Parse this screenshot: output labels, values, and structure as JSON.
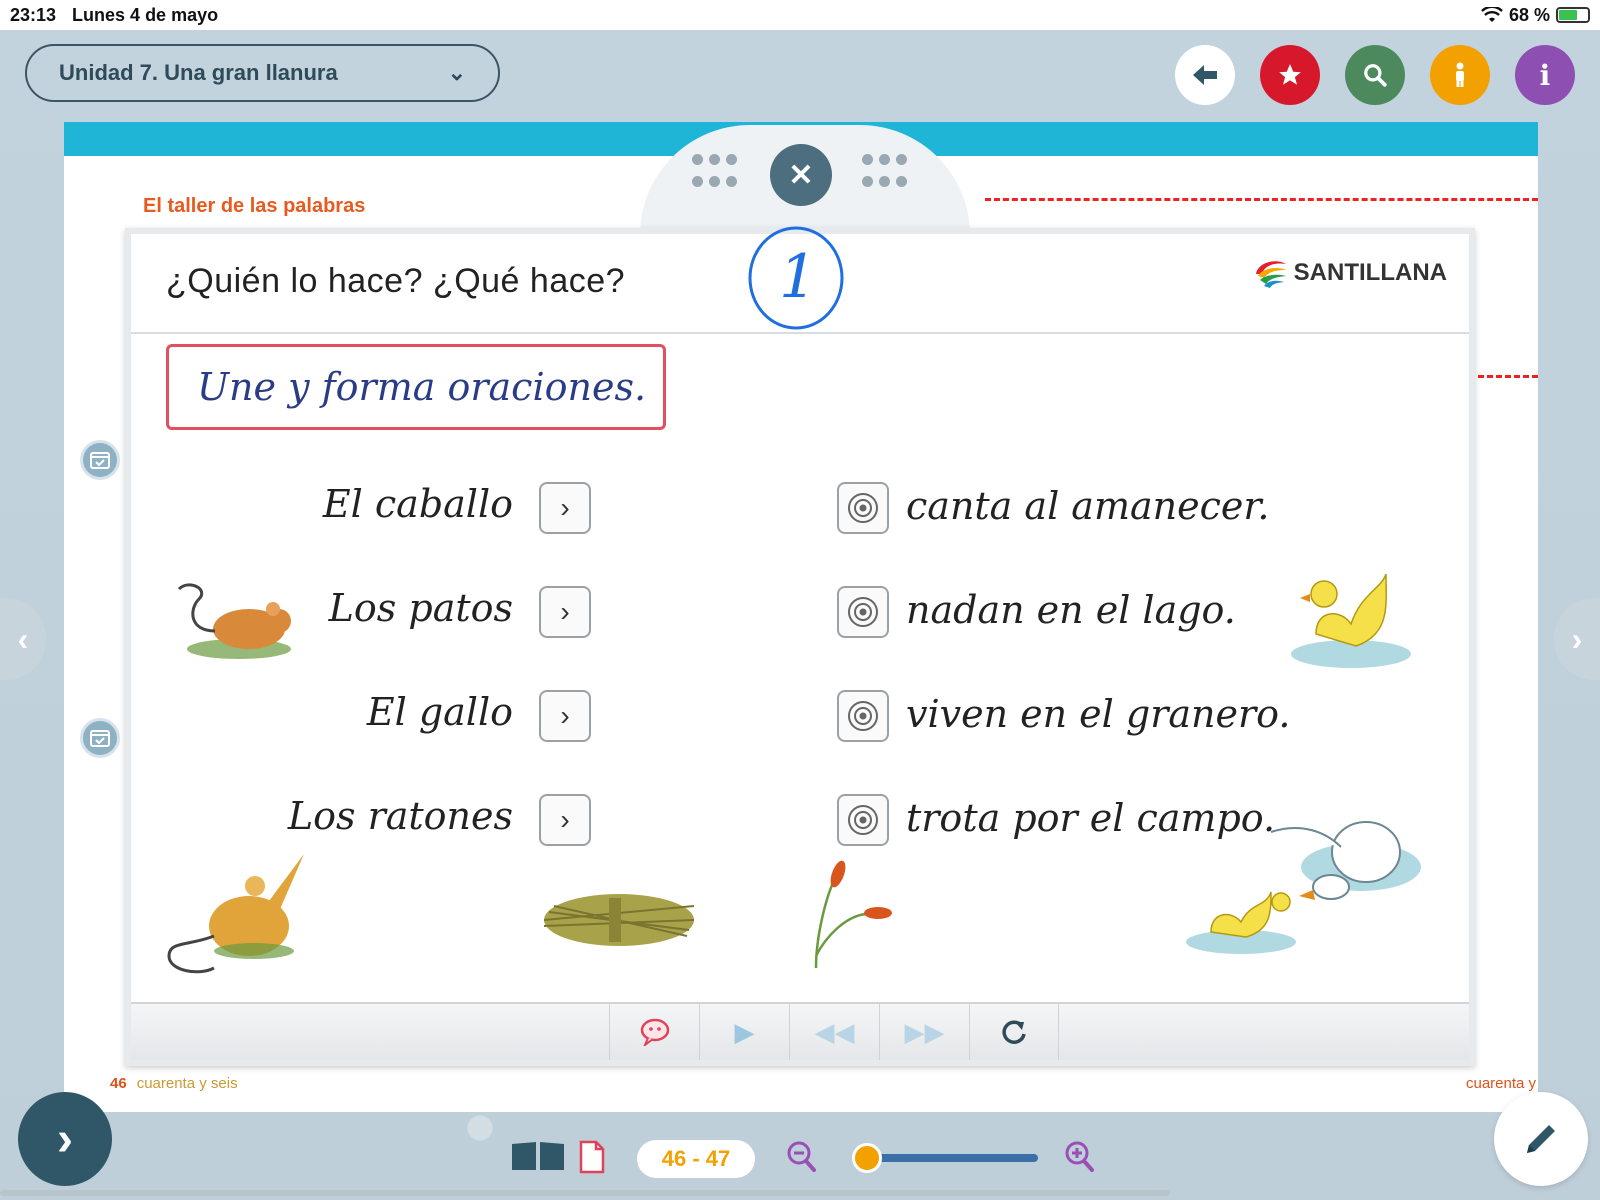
{
  "status_bar": {
    "time": "23:13",
    "date": "Lunes 4 de mayo",
    "battery": "68 %"
  },
  "header": {
    "unit_title": "Unidad 7. Una gran llanura",
    "buttons": [
      {
        "name": "back",
        "icon": "arrow-left-icon",
        "color": "#ffffff"
      },
      {
        "name": "favorites",
        "icon": "star-icon",
        "color": "#d7182a"
      },
      {
        "name": "search",
        "icon": "search-icon",
        "color": "#4c8a5d"
      },
      {
        "name": "accessibility",
        "icon": "person-icon",
        "color": "#f2a100"
      },
      {
        "name": "info",
        "icon": "info-icon",
        "color": "#8d4fb1"
      }
    ]
  },
  "book": {
    "section_title": "El taller de las palabras",
    "left_page_number": "46",
    "left_page_words": "cuarenta y seis",
    "right_page_words": "cuarenta y",
    "accent_color": "#1fb5d6"
  },
  "modal": {
    "title": "¿Quién lo hace? ¿Qué hace?",
    "annotation": "1",
    "brand": "SANTILLANA",
    "instruction": "Une y forma oraciones.",
    "subjects": [
      "El caballo",
      "Los patos",
      "El gallo",
      "Los ratones"
    ],
    "predicates": [
      "canta al amanecer.",
      "nadan en el lago.",
      "viven en el granero.",
      "trota por el campo."
    ],
    "toolbar": [
      "feedback",
      "play",
      "rewind",
      "fast-forward",
      "reset"
    ]
  },
  "footer": {
    "page_range": "46 - 47",
    "zoom_level": 0.05
  }
}
